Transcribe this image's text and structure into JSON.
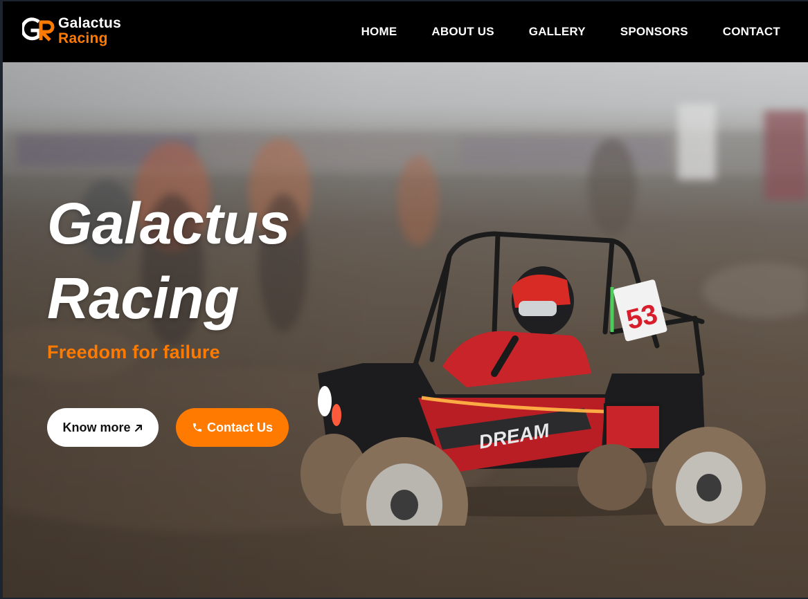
{
  "brand": {
    "logo_mark": "GR",
    "name_line1": "Galactus",
    "name_line2": "Racing",
    "accent_color": "#ff7a00"
  },
  "nav": {
    "items": [
      {
        "label": "HOME"
      },
      {
        "label": "ABOUT US"
      },
      {
        "label": "GALLERY"
      },
      {
        "label": "SPONSORS"
      },
      {
        "label": "CONTACT"
      }
    ]
  },
  "hero": {
    "title_line1": "Galactus",
    "title_line2": "Racing",
    "tagline": "Freedom for failure",
    "buttons": {
      "know_more": "Know more",
      "know_more_icon": "arrow-up-right-icon",
      "contact": "Contact Us",
      "contact_icon": "phone-icon"
    },
    "image": {
      "car_number": "53",
      "car_badge": "DREAM"
    }
  }
}
